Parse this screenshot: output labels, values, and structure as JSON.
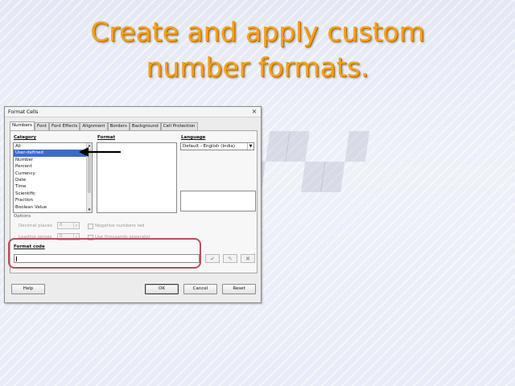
{
  "slide": {
    "title_line1": "Create and apply custom",
    "title_line2": "number formats."
  },
  "dialog": {
    "title": "Format Cells",
    "tabs": [
      {
        "label": "Numbers",
        "active": true
      },
      {
        "label": "Font",
        "active": false
      },
      {
        "label": "Font Effects",
        "active": false
      },
      {
        "label": "Alignment",
        "active": false
      },
      {
        "label": "Borders",
        "active": false
      },
      {
        "label": "Background",
        "active": false
      },
      {
        "label": "Cell Protection",
        "active": false
      }
    ],
    "category": {
      "label": "Category",
      "items": [
        "All",
        "User-defined",
        "Number",
        "Percent",
        "Currency",
        "Date",
        "Time",
        "Scientific",
        "Fraction",
        "Boolean Value"
      ],
      "selected": "User-defined"
    },
    "format": {
      "label": "Format"
    },
    "language": {
      "label": "Language",
      "value": "Default - English (India)"
    },
    "options": {
      "label": "Options",
      "decimal_places_label": "Decimal places",
      "decimal_places_value": "0",
      "leading_zeroes_label": "Leading zeroes",
      "leading_zeroes_value": "0",
      "negative_red_label": "Negative numbers red",
      "thousands_sep_label": "Use thousands separator"
    },
    "format_code": {
      "label": "Format code",
      "value": ""
    },
    "icons": {
      "accept": "checkmark-icon",
      "edit_comment": "edit-comment-icon",
      "delete": "delete-icon"
    },
    "buttons": {
      "help": "Help",
      "ok": "OK",
      "cancel": "Cancel",
      "reset": "Reset"
    }
  },
  "colors": {
    "title": "#f3a21f",
    "selection": "#3b6cc8",
    "highlight_box": "#b5505a"
  }
}
